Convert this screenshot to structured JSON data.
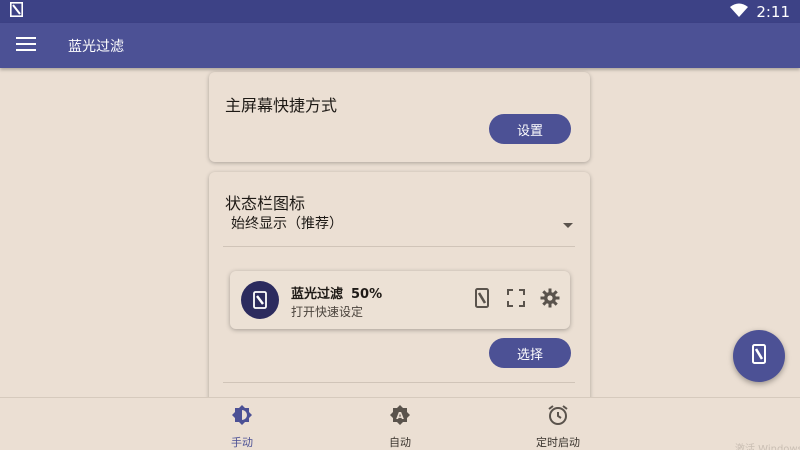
{
  "status_bar": {
    "time": "2:11"
  },
  "app_bar": {
    "title": "蓝光过滤",
    "menu_icon": "menu-icon"
  },
  "shortcut_card": {
    "title": "主屏幕快捷方式",
    "button_label": "设置"
  },
  "status_icon_card": {
    "title": "状态栏图标",
    "dropdown_value": "始终显示（推荐）",
    "notification_preview": {
      "title": "蓝光过滤",
      "percent": "50%",
      "subtitle": "打开快速设定"
    },
    "button_label": "选择"
  },
  "bottom_nav": {
    "items": [
      {
        "label": "手动",
        "icon": "brightness-icon",
        "active": true
      },
      {
        "label": "自动",
        "icon": "auto-brightness-icon",
        "active": false
      },
      {
        "label": "定时启动",
        "icon": "alarm-icon",
        "active": false
      }
    ]
  },
  "watermark": "激活 Windows",
  "colors": {
    "primary": "#4c5195",
    "status_bar": "#3d4286",
    "background": "#ebdfd3",
    "notif_icon_bg": "#2c2b5e"
  }
}
